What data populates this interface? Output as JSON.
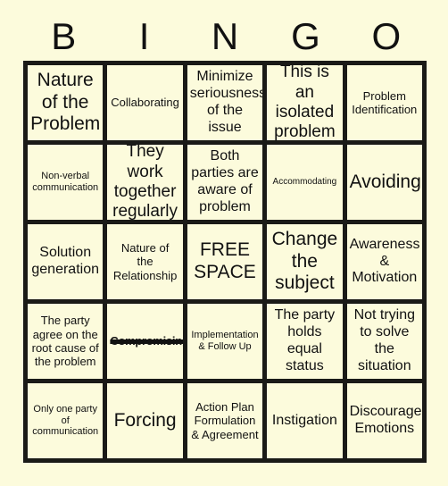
{
  "header": {
    "letters": [
      "B",
      "I",
      "N",
      "G",
      "O"
    ]
  },
  "colors": {
    "page_background": "#fcfbdc",
    "cell_background": "#fcfbdc",
    "grid_line": "#1a1a17",
    "text": "#111111"
  },
  "grid": {
    "columns": 5,
    "rows": 5,
    "cells": [
      {
        "text": "Nature\nof the\nProblem",
        "size": "fs-xl",
        "marked": false
      },
      {
        "text": "Collaborating",
        "size": "fs-sm",
        "marked": false
      },
      {
        "text": "Minimize\nseriousness\nof the issue",
        "size": "fs-md",
        "marked": false
      },
      {
        "text": "This is an\nisolated\nproblem",
        "size": "fs-lg",
        "marked": false
      },
      {
        "text": "Problem\nIdentification",
        "size": "fs-sm",
        "marked": false
      },
      {
        "text": "Non-verbal\ncommunication",
        "size": "fs-xs",
        "marked": false
      },
      {
        "text": "They work\ntogether\nregularly",
        "size": "fs-lg",
        "marked": false
      },
      {
        "text": "Both\nparties are\naware of\nproblem",
        "size": "fs-md",
        "marked": false
      },
      {
        "text": "Accommodating",
        "size": "fs-xxs",
        "marked": false
      },
      {
        "text": "Avoiding",
        "size": "fs-xl",
        "marked": false
      },
      {
        "text": "Solution\ngeneration",
        "size": "fs-md",
        "marked": false
      },
      {
        "text": "Nature of\nthe\nRelationship",
        "size": "fs-sm",
        "marked": false
      },
      {
        "text": "FREE\nSPACE",
        "size": "fs-xl",
        "marked": false
      },
      {
        "text": "Change\nthe\nsubject",
        "size": "fs-xl",
        "marked": false
      },
      {
        "text": "Awareness\n&\nMotivation",
        "size": "fs-md",
        "marked": false
      },
      {
        "text": "The party\nagree on the\nroot cause of\nthe problem",
        "size": "fs-sm",
        "marked": false
      },
      {
        "text": "Compromising",
        "size": "fs-sm",
        "marked": true
      },
      {
        "text": "Implementation\n& Follow Up",
        "size": "fs-xs",
        "marked": false
      },
      {
        "text": "The party\nholds\nequal\nstatus",
        "size": "fs-md",
        "marked": false
      },
      {
        "text": "Not trying\nto solve\nthe\nsituation",
        "size": "fs-md",
        "marked": false
      },
      {
        "text": "Only one party\nof\ncommunication",
        "size": "fs-xs",
        "marked": false
      },
      {
        "text": "Forcing",
        "size": "fs-xl",
        "marked": false
      },
      {
        "text": "Action Plan\nFormulation\n& Agreement",
        "size": "fs-sm",
        "marked": false
      },
      {
        "text": "Instigation",
        "size": "fs-md",
        "marked": false
      },
      {
        "text": "Discourage\nEmotions",
        "size": "fs-md",
        "marked": false
      }
    ]
  }
}
